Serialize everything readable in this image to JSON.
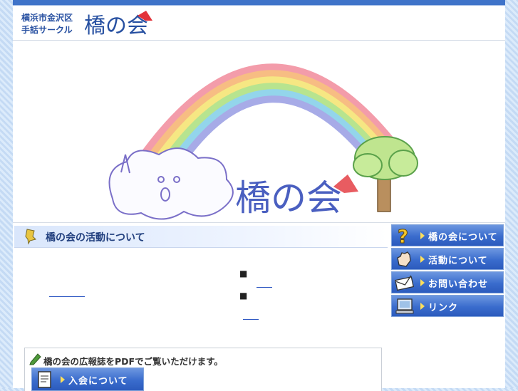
{
  "header": {
    "org_line1": "横浜市金沢区",
    "org_line2": "手話サークル",
    "logo_text": "橋の会"
  },
  "hero": {
    "logo_text": "橋の会"
  },
  "section": {
    "title": "橋の会の活動について",
    "gold_text": "　　　",
    "bullet1": "■",
    "bullet2": "■"
  },
  "nav": {
    "items": [
      {
        "label": "橋の会について",
        "icon": "question-icon"
      },
      {
        "label": "活動について",
        "icon": "hand-sign-icon"
      },
      {
        "label": "お問い合わせ",
        "icon": "envelope-icon"
      },
      {
        "label": "リンク",
        "icon": "computer-icon"
      }
    ]
  },
  "pdf": {
    "text": "橋の会の広報誌をPDFでご覧いただけます。",
    "join_label": "入会について"
  },
  "colors": {
    "accent": "#3a6ccd",
    "title_text": "#22407f",
    "gold": "#7b7b00"
  }
}
